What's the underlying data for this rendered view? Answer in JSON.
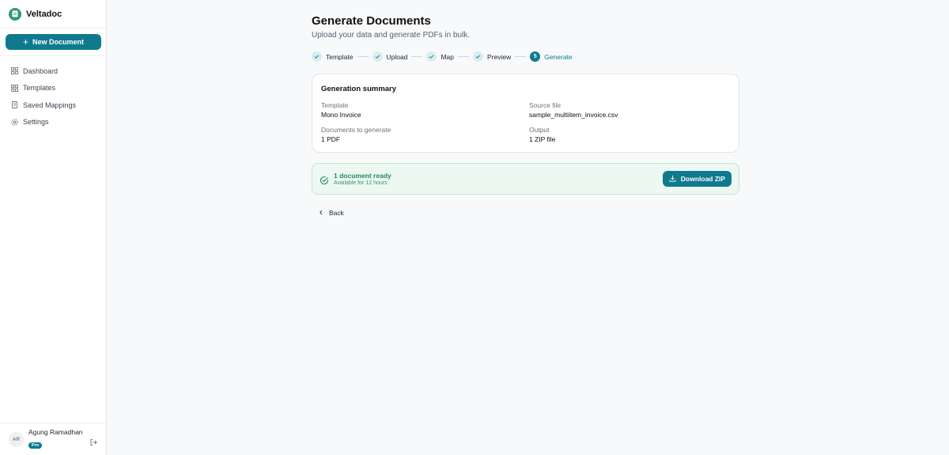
{
  "brand": {
    "name": "Veltadoc"
  },
  "sidebar": {
    "new_document_label": "New Document",
    "items": [
      {
        "label": "Dashboard",
        "icon": "dashboard-icon"
      },
      {
        "label": "Templates",
        "icon": "templates-icon"
      },
      {
        "label": "Saved Mappings",
        "icon": "bookmark-icon"
      },
      {
        "label": "Settings",
        "icon": "gear-icon"
      }
    ]
  },
  "user": {
    "initials": "AR",
    "name": "Agung Ramadhan",
    "plan": "Pro"
  },
  "page": {
    "title": "Generate Documents",
    "subtitle": "Upload your data and generate PDFs in bulk."
  },
  "stepper": {
    "steps": [
      {
        "label": "Template",
        "state": "done"
      },
      {
        "label": "Upload",
        "state": "done"
      },
      {
        "label": "Map",
        "state": "done"
      },
      {
        "label": "Preview",
        "state": "done"
      },
      {
        "label": "Generate",
        "state": "active",
        "number": "5"
      }
    ]
  },
  "summary": {
    "title": "Generation summary",
    "template_label": "Template",
    "template_value": "Mono Invoice",
    "source_label": "Source file",
    "source_value": "sample_multiitem_invoice.csv",
    "count_label": "Documents to generate",
    "count_value": "1 PDF",
    "output_label": "Output",
    "output_value": "1 ZIP file"
  },
  "ready": {
    "title": "1 document ready",
    "subtitle": "Available for 12 hours",
    "download_label": "Download ZIP"
  },
  "back_label": "Back",
  "colors": {
    "accent": "#0f7a8e",
    "success": "#1f8a57",
    "success_bg": "#edf8f2"
  }
}
